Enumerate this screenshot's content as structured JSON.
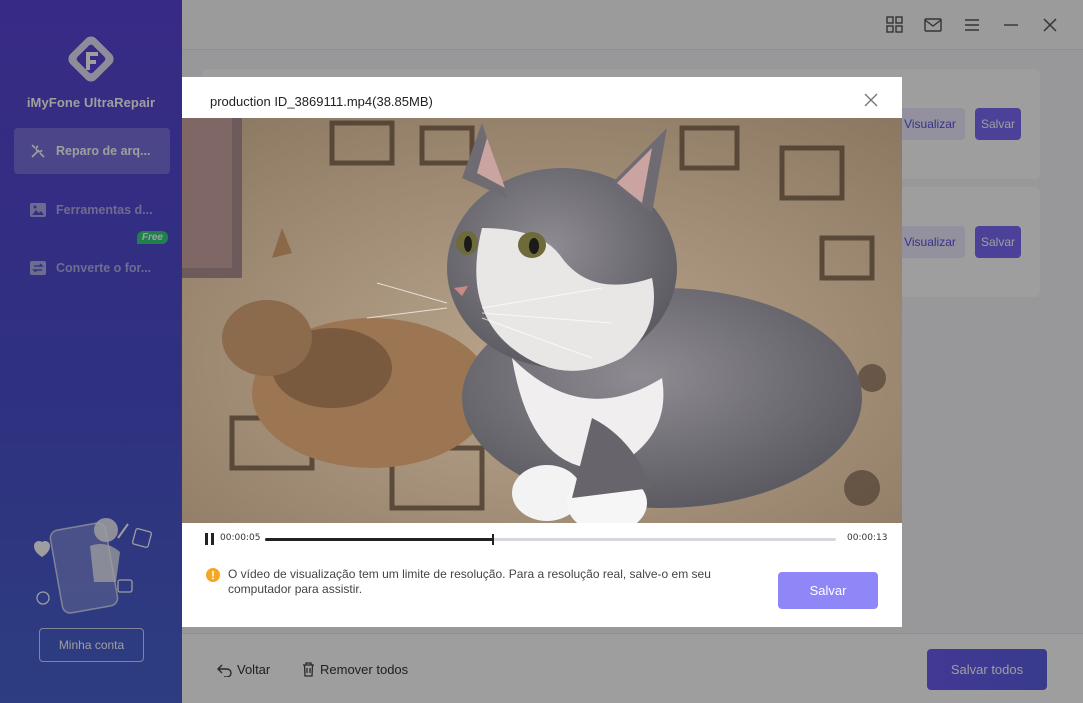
{
  "sidebar": {
    "app_name": "iMyFone UltraRepair",
    "items": [
      {
        "label": "Reparo de arq...",
        "icon": "repair-tools-icon",
        "active": true
      },
      {
        "label": "Ferramentas d...",
        "icon": "image-icon",
        "active": false
      },
      {
        "label": "Converte o for...",
        "icon": "convert-icon",
        "active": false,
        "badge": "Free"
      }
    ],
    "account_label": "Minha conta"
  },
  "titlebar": {
    "icons": [
      "grid-icon",
      "mail-icon",
      "menu-icon",
      "minimize-icon",
      "close-icon"
    ]
  },
  "list": {
    "rows": [
      {
        "preview_label": "Visualizar",
        "save_label": "Salvar"
      },
      {
        "preview_label": "Visualizar",
        "save_label": "Salvar"
      }
    ]
  },
  "bottom": {
    "back_label": "Voltar",
    "remove_all_label": "Remover todos",
    "save_all_label": "Salvar todos"
  },
  "modal": {
    "title": "production ID_3869111.mp4(38.85MB)",
    "current_time": "00:00:05",
    "total_time": "00:00:13",
    "progress": 0.4,
    "notice": "O vídeo de visualização tem um limite de resolução. Para a resolução real, salve-o em seu computador para assistir.",
    "save_label": "Salvar"
  },
  "colors": {
    "accent": "#7a6af5",
    "sidebar_top": "#5a45d8",
    "sidebar_bottom": "#4963cf",
    "free_badge": "#2fcf7d",
    "notice_icon": "#f5a623"
  }
}
